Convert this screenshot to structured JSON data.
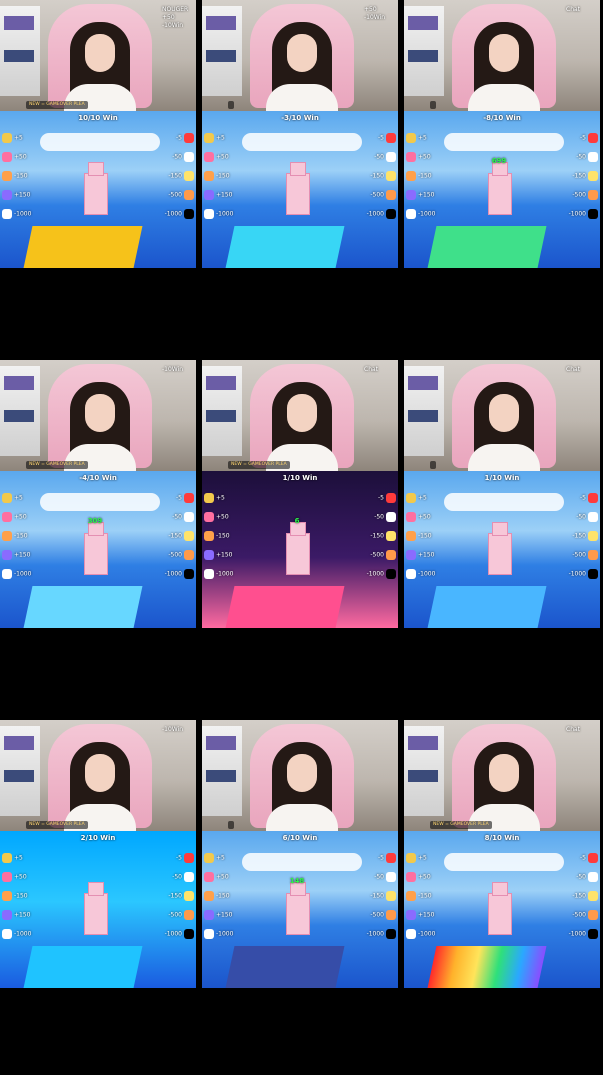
{
  "grid": {
    "tiles": [
      {
        "win": "10/10 Win",
        "count": "",
        "cam_badge_top": "NOUGER",
        "cam_badge_2": "+50",
        "cam_badge_3": "-10Win",
        "cam_caption": "NEW = GAMEOVER PLEA",
        "platform": "#f6c21a"
      },
      {
        "win": "-3/10 Win",
        "count": "",
        "cam_badge_top": "",
        "cam_badge_2": "+50",
        "cam_badge_3": "-10Win",
        "cam_caption": "",
        "platform": "#38d6f5"
      },
      {
        "win": "-8/10 Win",
        "count": "699",
        "cam_badge_top": "Chat",
        "cam_badge_2": "",
        "cam_badge_3": "",
        "cam_caption": "",
        "platform": "#3fe08a"
      },
      {
        "win": "-4/10 Win",
        "count": "309",
        "cam_badge_top": "",
        "cam_badge_2": "",
        "cam_badge_3": "-10Win",
        "cam_caption": "NEW = GAMEOVER PLEA",
        "platform": "#67d7ff"
      },
      {
        "win": "1/10 Win",
        "count": "6",
        "cam_badge_top": "Chat",
        "cam_badge_2": "",
        "cam_badge_3": "",
        "cam_caption": "NEW = GAMEOVER PLEA",
        "platform": "#ff4f8f"
      },
      {
        "win": "1/10 Win",
        "count": "",
        "cam_badge_top": "Chat",
        "cam_badge_2": "",
        "cam_badge_3": "",
        "cam_caption": "",
        "platform": "#49b6ff"
      },
      {
        "win": "2/10 Win",
        "count": "",
        "cam_badge_top": "",
        "cam_badge_2": "",
        "cam_badge_3": "-10Win",
        "cam_caption": "NEW = GAMEOVER PLEA",
        "platform": "#1fc3ff"
      },
      {
        "win": "6/10 Win",
        "count": "148",
        "cam_badge_top": "",
        "cam_badge_2": "",
        "cam_badge_3": "",
        "cam_caption": "",
        "platform": "#364da8"
      },
      {
        "win": "8/10 Win",
        "count": "",
        "cam_badge_top": "Chat",
        "cam_badge_2": "",
        "cam_badge_3": "",
        "cam_caption": "NEW = GAMEOVER PLEA",
        "platform": "#ff3a6b"
      }
    ],
    "gifts_left": [
      "+5",
      "+50",
      "-150",
      "+150",
      "-1000"
    ],
    "gifts_right": [
      "-5",
      "-50",
      "-150",
      "-500",
      "-1000"
    ],
    "colors": {
      "gift_swatches": [
        "#f2c94c",
        "#ff6fa0",
        "#ffa04a",
        "#8a6bff",
        "#ffffff"
      ]
    }
  }
}
